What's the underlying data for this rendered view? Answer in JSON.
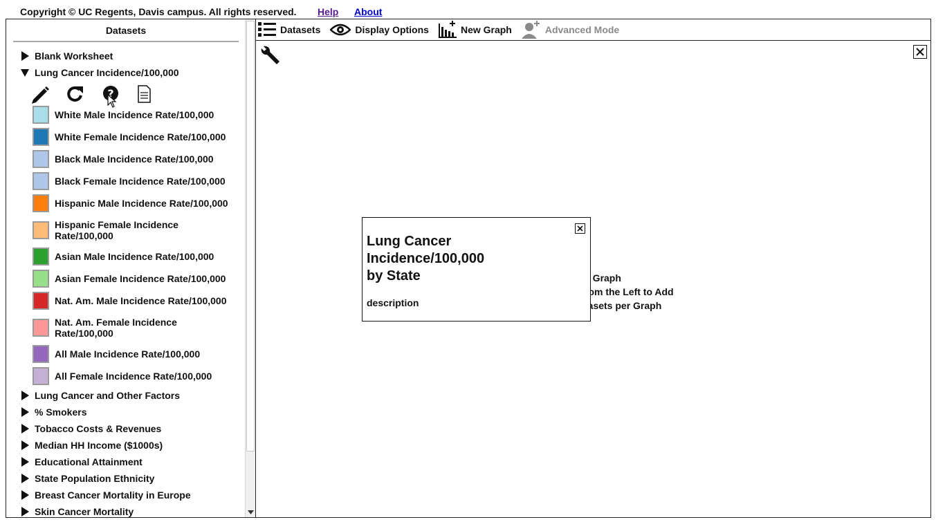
{
  "header": {
    "copyright": "Copyright © UC Regents, Davis campus. All rights reserved.",
    "help_link": "Help",
    "about_link": "About"
  },
  "sidebar": {
    "title": "Datasets",
    "groups": [
      {
        "label": "Blank Worksheet",
        "expanded": false
      },
      {
        "label": "Lung Cancer Incidence/100,000",
        "expanded": true
      },
      {
        "label": "Lung Cancer and Other Factors",
        "expanded": false
      },
      {
        "label": "% Smokers",
        "expanded": false
      },
      {
        "label": "Tobacco Costs & Revenues",
        "expanded": false
      },
      {
        "label": "Median HH Income ($1000s)",
        "expanded": false
      },
      {
        "label": "Educational Attainment",
        "expanded": false
      },
      {
        "label": "State Population Ethnicity",
        "expanded": false
      },
      {
        "label": "Breast Cancer Mortality in Europe",
        "expanded": false
      },
      {
        "label": "Skin Cancer Mortality",
        "expanded": false
      }
    ],
    "dataset_tools": [
      "pencil-icon",
      "refresh-icon",
      "help-circle-icon",
      "document-icon"
    ],
    "series": [
      {
        "label": "White Male Incidence Rate/100,000",
        "color": "#a8dde9"
      },
      {
        "label": "White Female Incidence Rate/100,000",
        "color": "#1f77b4"
      },
      {
        "label": "Black Male Incidence Rate/100,000",
        "color": "#aec7e8"
      },
      {
        "label": "Black Female Incidence Rate/100,000",
        "color": "#aec7e8"
      },
      {
        "label": "Hispanic Male Incidence Rate/100,000",
        "color": "#ff7f0e"
      },
      {
        "label": "Hispanic Female Incidence Rate/100,000",
        "color": "#ffbb78"
      },
      {
        "label": "Asian Male Incidence Rate/100,000",
        "color": "#2ca02c"
      },
      {
        "label": "Asian Female Incidence Rate/100,000",
        "color": "#98df8a"
      },
      {
        "label": "Nat. Am. Male Incidence Rate/100,000",
        "color": "#d62728"
      },
      {
        "label": "Nat. Am. Female Incidence Rate/100,000",
        "color": "#ff9896"
      },
      {
        "label": "All Male Incidence Rate/100,000",
        "color": "#9467bd"
      },
      {
        "label": "All Female Incidence Rate/100,000",
        "color": "#c5b0d5"
      }
    ]
  },
  "toolbar": {
    "datasets_label": "Datasets",
    "display_options_label": "Display Options",
    "new_graph_label": "New Graph",
    "advanced_mode_label": "Advanced Mode"
  },
  "main": {
    "hint_lines": [
      "y Graph",
      "rom the Left to Add",
      "tasets per Graph"
    ]
  },
  "popup": {
    "title_lines": [
      "Lung Cancer",
      "Incidence/100,000",
      "by State"
    ],
    "description": "description"
  }
}
